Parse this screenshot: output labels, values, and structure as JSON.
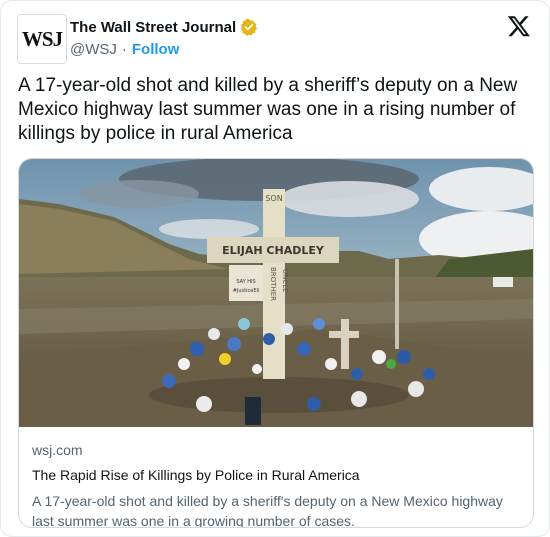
{
  "author": {
    "avatar_text": "WSJ",
    "name": "The Wall Street Journal",
    "handle": "@WSJ",
    "separator": "·",
    "follow_label": "Follow",
    "verified_color": "#e2b719"
  },
  "tweet": {
    "text": "A 17-year-old shot and killed by a sheriff’s deputy on a New Mexico highway last summer was one in a rising number of killings by police in rural America"
  },
  "link_card": {
    "domain": "wsj.com",
    "title": "The Rapid Rise of Killings by Police in Rural America",
    "description": "A 17-year-old shot and killed by a sheriff's deputy on a New Mexico highway last summer was one in a growing number of cases.",
    "image": {
      "cross_top": "SON",
      "cross_name": "ELIJAH CHADLEY",
      "cross_vertical": "BROTHER",
      "cross_vertical_right": "UNCLE",
      "cross_sign_line1": "SAY HIS",
      "cross_sign_line2": "#JusticeEli"
    }
  },
  "colors": {
    "accent": "#1d9bf0",
    "text": "#0f1419",
    "secondary": "#536471"
  }
}
